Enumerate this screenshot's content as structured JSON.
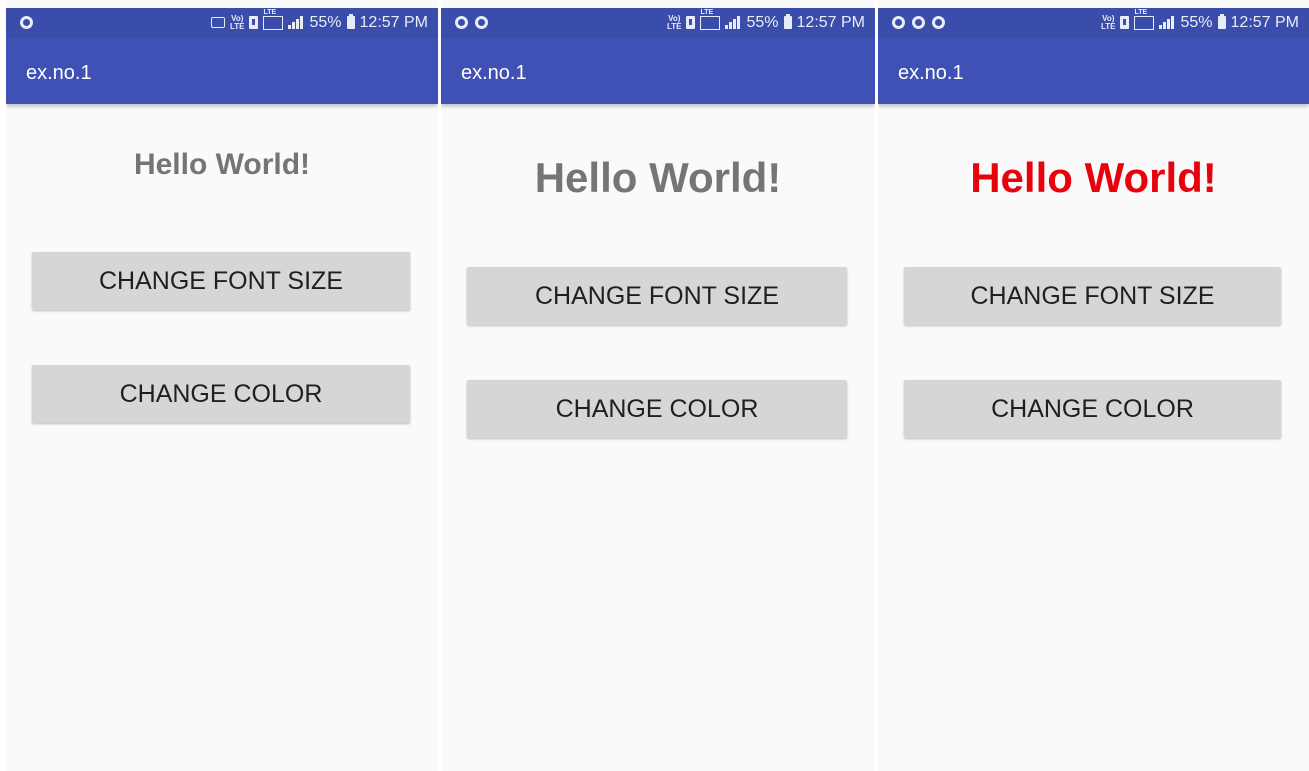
{
  "screens": [
    {
      "status": {
        "battery": "55%",
        "time": "12:57 PM"
      },
      "app_title": "ex.no.1",
      "hello_text": "Hello World!",
      "buttons": {
        "font_size": "CHANGE FONT SIZE",
        "color": "CHANGE COLOR"
      },
      "hello_color": "#757575"
    },
    {
      "status": {
        "battery": "55%",
        "time": "12:57 PM"
      },
      "app_title": "ex.no.1",
      "hello_text": "Hello World!",
      "buttons": {
        "font_size": "CHANGE FONT SIZE",
        "color": "CHANGE COLOR"
      },
      "hello_color": "#757575"
    },
    {
      "status": {
        "battery": "55%",
        "time": "12:57 PM"
      },
      "app_title": "ex.no.1",
      "hello_text": "Hello World!",
      "buttons": {
        "font_size": "CHANGE FONT SIZE",
        "color": "CHANGE COLOR"
      },
      "hello_color": "#e8020b"
    }
  ],
  "colors": {
    "status_bar": "#3a4daa",
    "app_bar": "#3f51b5",
    "button": "#d6d6d6",
    "background": "#fafafa"
  }
}
